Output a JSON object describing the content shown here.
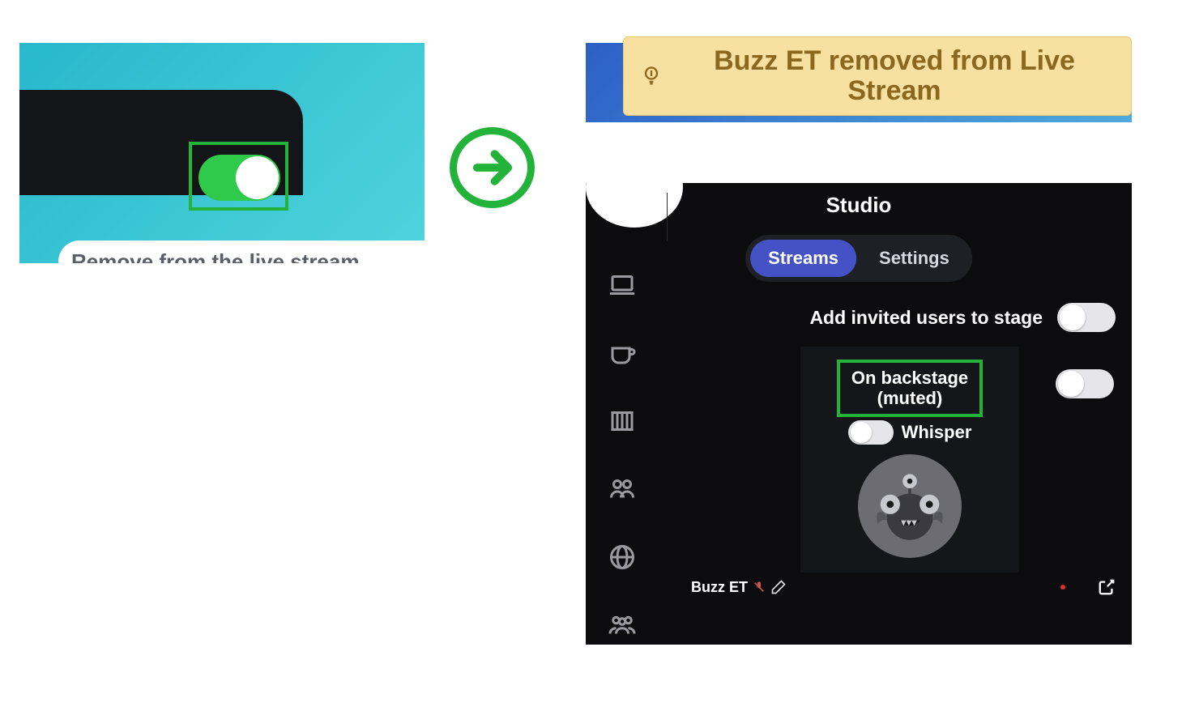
{
  "left_panel": {
    "tooltip": "Remove from the live stream"
  },
  "toast": {
    "message": "Buzz ET removed from Live Stream"
  },
  "studio": {
    "title": "Studio",
    "tabs": {
      "streams": "Streams",
      "settings": "Settings"
    },
    "add_invited_label": "Add invited users to stage",
    "backstage_label_line1": "On backstage",
    "backstage_label_line2": "(muted)",
    "whisper_label": "Whisper",
    "user_name": "Buzz ET"
  }
}
